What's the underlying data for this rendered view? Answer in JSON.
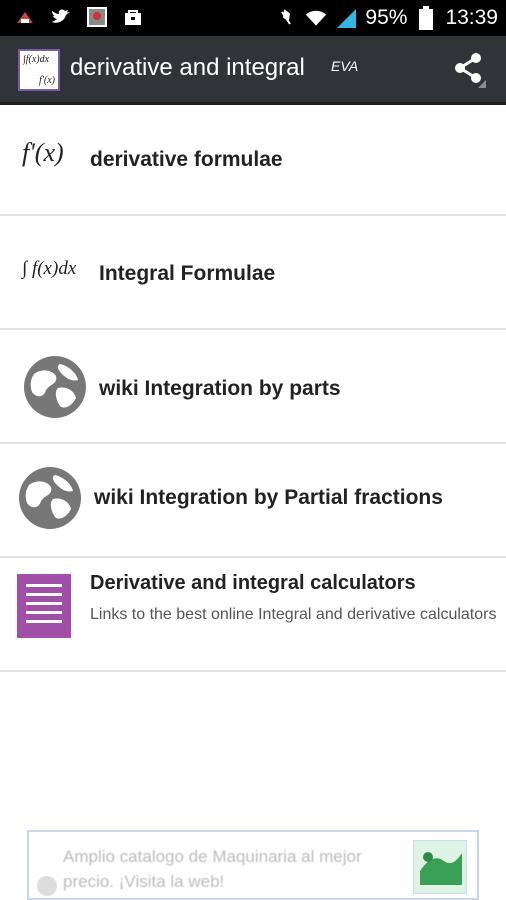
{
  "status_bar": {
    "battery": "95%",
    "time": "13:39",
    "icons": [
      "alert-icon",
      "twitter-icon",
      "photo-icon",
      "bag-icon",
      "muted-icon",
      "wifi-icon",
      "signal-icon",
      "battery-icon"
    ]
  },
  "action_bar": {
    "app_icon": {
      "line1": "∫f(x)dx",
      "line2": "f'(x)"
    },
    "title": "derivative and integral",
    "badge": "EVA",
    "share_icon": "share-icon"
  },
  "list": {
    "items": [
      {
        "icon": "derivative-formula-icon",
        "icon_text": "f'(x)",
        "label": "derivative formulae"
      },
      {
        "icon": "integral-formula-icon",
        "icon_text": "∫ f(x)dx",
        "label": "Integral Formulae"
      },
      {
        "icon": "globe-icon",
        "label": "wiki Integration by parts"
      },
      {
        "icon": "globe-icon",
        "label": "wiki Integration by Partial fractions"
      },
      {
        "icon": "notebook-icon",
        "label": "Derivative and integral calculators",
        "description": "Links to the best online Integral and derivative calculators"
      }
    ]
  },
  "ad": {
    "text": "Amplio catalogo de Maquinaria al mejor precio. ¡Visita la web!"
  },
  "colors": {
    "action_bar": "#303438",
    "status_bar": "#000000",
    "accent": "#a14ea8",
    "divider": "#e2e2e2"
  }
}
